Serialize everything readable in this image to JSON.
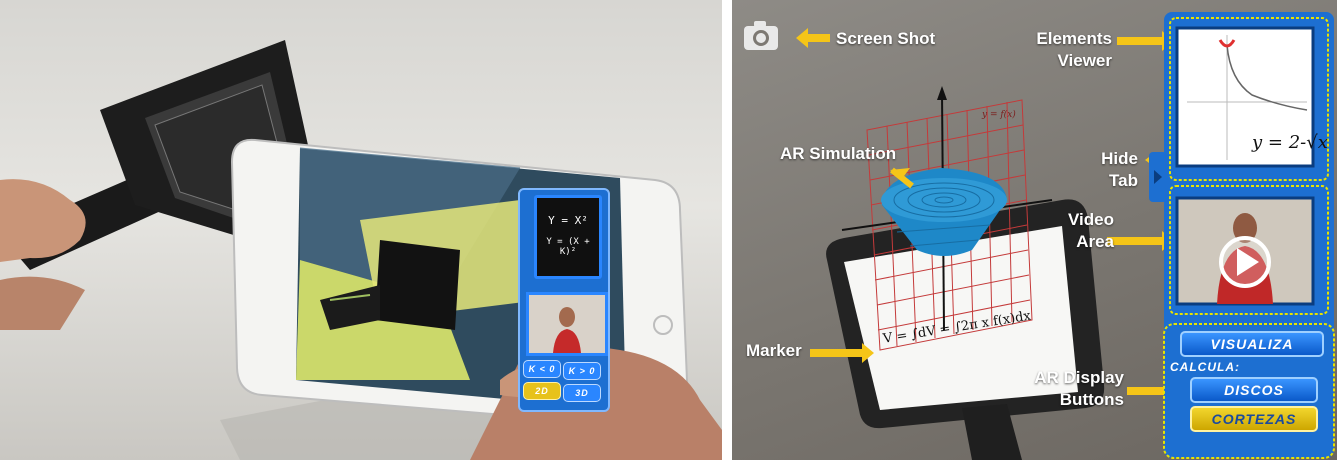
{
  "left_photo": {
    "ipad_screen": {
      "formula_card": {
        "line1": "Y = X²",
        "line2": "Y = (X + K)²"
      },
      "buttons": {
        "k_neg": "K < 0",
        "k_pos": "K > 0",
        "mode_2d": "2D",
        "mode_3d": "3D"
      }
    }
  },
  "right_screenshot": {
    "callouts": {
      "screen_shot": "Screen Shot",
      "elements_viewer": [
        "Elements",
        "Viewer"
      ],
      "ar_simulation": "AR Simulation",
      "hide_tab": [
        "Hide",
        "Tab"
      ],
      "video_area": [
        "Video",
        "Area"
      ],
      "marker": "Marker",
      "ar_display_buttons": [
        "AR Display",
        "Buttons"
      ]
    },
    "viewer_formula": "y = 2-√x",
    "graph_label": "y = f(x)",
    "marker_formula": "V = ∫dV = ∫2π x f(x)dx",
    "buttons": {
      "visualiza": "VISUALIZA",
      "calcula": "CALCULA:",
      "discos": "DISCOS",
      "cortezas": "CORTEZAS"
    },
    "colors": {
      "callout_arrow": "#f5c518",
      "panel_blue": "#1d6fd1",
      "panel_border_yellow": "#e7e300",
      "surface_blue": "#1e88c8"
    }
  }
}
